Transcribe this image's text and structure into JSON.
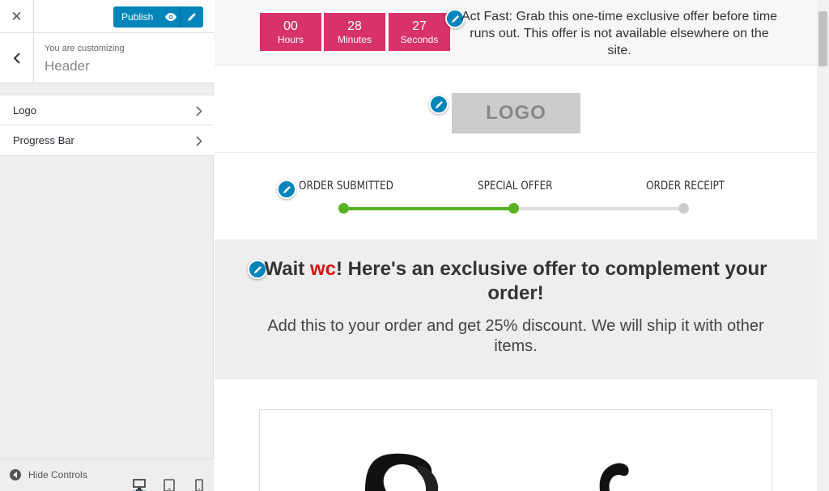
{
  "customizer": {
    "close_icon": "close-icon",
    "publish_label": "Publish",
    "publish_icons": [
      "eye-icon",
      "pencil-icon"
    ],
    "back_icon": "chevron-left-icon",
    "you_are_customizing": "You are customizing",
    "section_title": "Header",
    "items": [
      {
        "label": "Logo",
        "icon": "chevron-right-icon"
      },
      {
        "label": "Progress Bar",
        "icon": "chevron-right-icon"
      }
    ],
    "footer": {
      "hide_controls": "Hide Controls",
      "devices": [
        "desktop-icon",
        "tablet-icon",
        "mobile-icon"
      ]
    }
  },
  "preview": {
    "countdown": [
      {
        "value": "00",
        "unit": "Hours"
      },
      {
        "value": "28",
        "unit": "Minutes"
      },
      {
        "value": "27",
        "unit": "Seconds"
      }
    ],
    "countdown_color": "#d8326a",
    "timer_message": "Act Fast: Grab this one-time exclusive offer before time runs out. This offer is not available elsewhere on the site.",
    "logo_text": "LOGO",
    "progress_steps": [
      "ORDER SUBMITTED",
      "SPECIAL OFFER",
      "ORDER RECEIPT"
    ],
    "progress_fraction": 0.5,
    "progress_active_color": "#56b322",
    "offer_heading": {
      "before": "Wait ",
      "highlight": "wc",
      "after": "! Here's an exclusive offer to complement your order!"
    },
    "offer_subtext": "Add this to your order and get 25% discount. We will ship it with other items.",
    "accent_color": "#0085ba"
  }
}
